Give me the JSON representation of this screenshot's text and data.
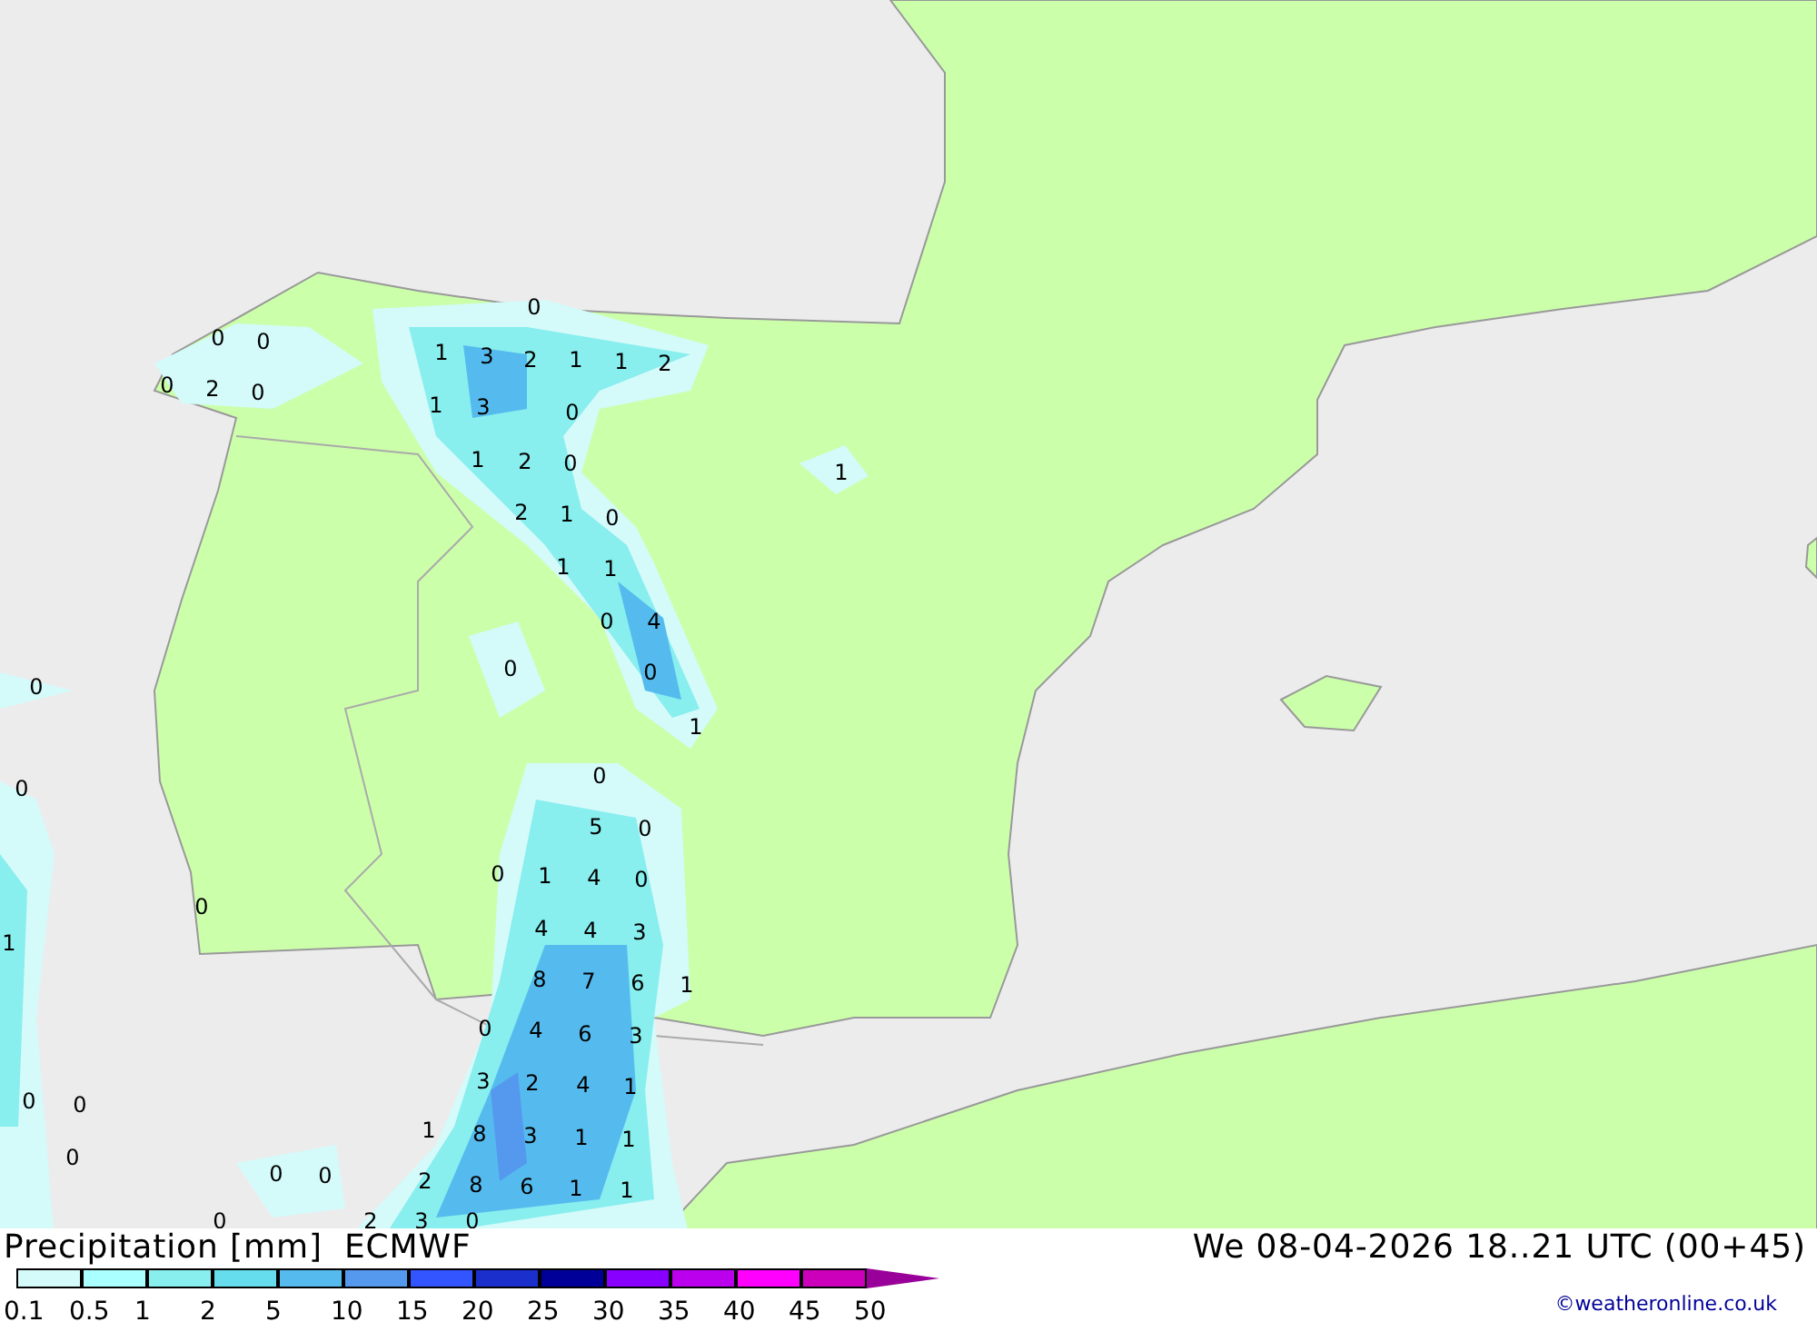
{
  "map": {
    "values": [
      "0",
      "0",
      "0",
      "0",
      "2",
      "0",
      "1",
      "3",
      "2",
      "1",
      "1",
      "2",
      "1",
      "3",
      "0",
      "1",
      "2",
      "0",
      "1",
      "2",
      "1",
      "0",
      "1",
      "1",
      "0",
      "4",
      "0",
      "0",
      "1",
      "0",
      "0",
      "0",
      "5",
      "0",
      "0",
      "1",
      "4",
      "0",
      "0",
      "1",
      "4",
      "4",
      "3",
      "8",
      "7",
      "6",
      "1",
      "0",
      "4",
      "6",
      "3",
      "3",
      "2",
      "4",
      "1",
      "0",
      "0",
      "1",
      "8",
      "3",
      "1",
      "1",
      "0",
      "0",
      "0",
      "2",
      "8",
      "6",
      "1",
      "1",
      "0",
      "2",
      "3",
      "0"
    ]
  },
  "legend": {
    "title": "Precipitation [mm]",
    "model": "ECMWF",
    "bins": [
      {
        "label": "0.1",
        "color": "#d4fafa"
      },
      {
        "label": "0.5",
        "color": "#aaffff"
      },
      {
        "label": "1",
        "color": "#88eeee"
      },
      {
        "label": "2",
        "color": "#66dded"
      },
      {
        "label": "5",
        "color": "#55bbee"
      },
      {
        "label": "10",
        "color": "#5599ee"
      },
      {
        "label": "15",
        "color": "#3355ff"
      },
      {
        "label": "20",
        "color": "#1a2fcc"
      },
      {
        "label": "25",
        "color": "#000099"
      },
      {
        "label": "30",
        "color": "#8800ff"
      },
      {
        "label": "35",
        "color": "#bb00ee"
      },
      {
        "label": "40",
        "color": "#ff00ff"
      },
      {
        "label": "45",
        "color": "#cc00bb"
      },
      {
        "label": "50",
        "color": "#990099"
      }
    ]
  },
  "valid_time": "We 08-04-2026 18..21 UTC (00+45)",
  "credit": "©weatheronline.co.uk"
}
